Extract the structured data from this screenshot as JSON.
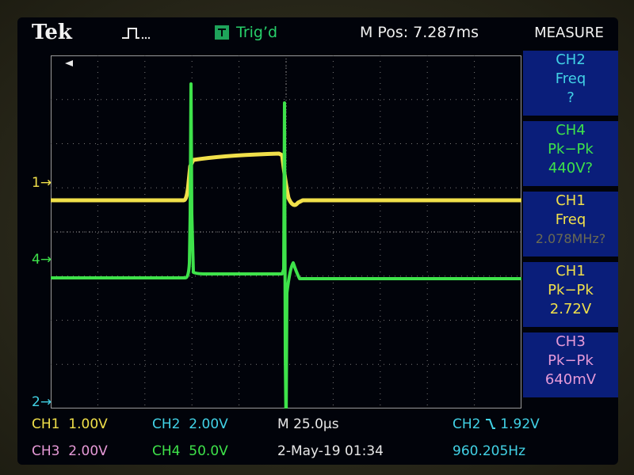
{
  "header": {
    "brand": "Tek",
    "trigger_status": "Trig’d",
    "horizontal_position": "M Pos: 7.287ms"
  },
  "measure_panel": {
    "title": "MEASURE",
    "items": [
      {
        "channel": "CH2",
        "type": "Freq",
        "value": "?"
      },
      {
        "channel": "CH4",
        "type": "Pk−Pk",
        "value": "440V?"
      },
      {
        "channel": "CH1",
        "type": "Freq",
        "value": "2.078MHz?"
      },
      {
        "channel": "CH1",
        "type": "Pk−Pk",
        "value": "2.72V"
      },
      {
        "channel": "CH3",
        "type": "Pk−Pk",
        "value": "640mV"
      }
    ]
  },
  "channel_markers": {
    "ch1": "1",
    "ch4": "4",
    "ch2": "2"
  },
  "readouts": {
    "ch1_label": "CH1",
    "ch1_scale": "1.00V",
    "ch2_label": "CH2",
    "ch2_scale": "2.00V",
    "ch3_label": "CH3",
    "ch3_scale": "2.00V",
    "ch4_label": "CH4",
    "ch4_scale": "50.0V",
    "timebase": "M 25.0µs",
    "date_time": "2-May-19 01:34",
    "trigger_source": "CH2",
    "trigger_slope_icon": "falling-edge-icon",
    "trigger_level": "1.92V",
    "trigger_freq": "960.205Hz"
  },
  "colors": {
    "ch1": "#f1e04a",
    "ch2": "#42d2e6",
    "ch3": "#e69ad8",
    "ch4": "#3ee24a",
    "measure_bg": "#0a1e7a"
  },
  "chart_data": {
    "type": "line",
    "grid": true,
    "divisions": {
      "x": 10,
      "y": 8
    },
    "series": [
      {
        "name": "CH1",
        "values": []
      },
      {
        "name": "CH4",
        "values": []
      }
    ]
  }
}
